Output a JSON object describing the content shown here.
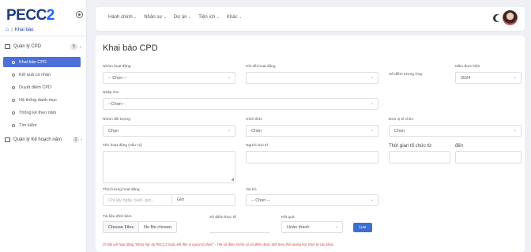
{
  "brand": {
    "logo_a": "PECC",
    "logo_b": "2"
  },
  "breadcrumb": {
    "label": "Khai báo"
  },
  "sidebar": {
    "group1": {
      "label": "Quản lý CPD",
      "badge": "5"
    },
    "items": [
      {
        "label": "Khai báo CPD",
        "active": true
      },
      {
        "label": "Kết quả cá nhân"
      },
      {
        "label": "Duyệt điểm CPD"
      },
      {
        "label": "Hệ thống danh mục"
      },
      {
        "label": "Thống kê theo năm"
      },
      {
        "label": "Tìm kiếm"
      }
    ],
    "group2": {
      "label": "Quản lý Kế hoạch năm",
      "badge": "2"
    }
  },
  "topnav": [
    "Hành chính",
    "Nhân sự",
    "Dự án",
    "Tiện ích",
    "Khác"
  ],
  "page": {
    "title": "Khai báo CPD"
  },
  "form": {
    "nhom_hoat_dong": {
      "label": "Nhóm hoạt động",
      "value": "-- Chọn --"
    },
    "chi_tiet": {
      "label": "Chi tiết hoạt động",
      "value": ""
    },
    "so_diem_ung": {
      "label": "Số điểm tương ứng:"
    },
    "nam": {
      "label": "Năm thực hiện",
      "value": "2024"
    },
    "nhap_cho": {
      "label": "Nhập cho",
      "value": "--Chọn--"
    },
    "nhom_doi_tuong": {
      "label": "Nhóm đối tượng",
      "value": "Chọn"
    },
    "hinh_thuc": {
      "label": "Hình thức",
      "value": "Chọn"
    },
    "don_vi": {
      "label": "Đơn vị tổ chức",
      "value": "Chọn"
    },
    "ten_hoat_dong": {
      "label": "Tên hoạt động (nếu có)"
    },
    "nguoi_chu_tri": {
      "label": "Người chủ trì"
    },
    "thoi_gian_tu": {
      "label": "Thời gian tổ chức từ"
    },
    "den": {
      "label": "đến"
    },
    "thoi_luong": {
      "label": "Thời lượng hoạt động",
      "placeholder": "Chỉ lấy ngày, buổi, giờ...",
      "unit": "Giờ"
    },
    "vai_tro": {
      "label": "Vai trò",
      "value": "-- Chọn --"
    },
    "tai_lieu": {
      "label": "Tài liệu đính kèm",
      "button": "Choose Files",
      "file": "No file chosen"
    },
    "so_diem_thuc_te": {
      "label": "Số điểm thực tế"
    },
    "ket_qua": {
      "label": "Kết quả",
      "value": "Hoàn thành"
    },
    "submit": "Lưu",
    "note": "(*) Đối với hoạt động \"Khóa học do PECC2 hoặc kết đôn vị ngoài tổ chức\" - Tiết số điểm chính có số điểm được tính theo thời lượng học thực tế của khóa"
  },
  "colors": {
    "accent": "#4c6fd8",
    "brand": "#1e3a8a",
    "note": "#d94040"
  }
}
